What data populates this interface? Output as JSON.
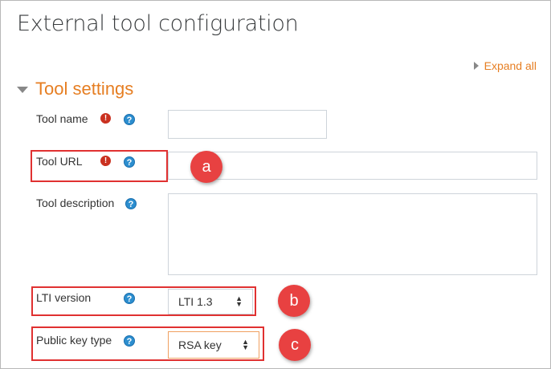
{
  "page": {
    "title": "External tool configuration",
    "expand_all": "Expand all"
  },
  "section": {
    "title": "Tool settings"
  },
  "fields": {
    "tool_name": {
      "label": "Tool name",
      "value": ""
    },
    "tool_url": {
      "label": "Tool URL",
      "value": ""
    },
    "tool_description": {
      "label": "Tool description",
      "value": ""
    },
    "lti_version": {
      "label": "LTI version",
      "selected": "LTI 1.3"
    },
    "public_key_type": {
      "label": "Public key type",
      "selected": "RSA key"
    }
  },
  "icons": {
    "required": "!",
    "help": "?"
  },
  "callouts": {
    "a": "a",
    "b": "b",
    "c": "c"
  },
  "colors": {
    "accent": "#e67e22",
    "callout": "#e84141",
    "required": "#ca3120",
    "help": "#2c8ecf"
  }
}
